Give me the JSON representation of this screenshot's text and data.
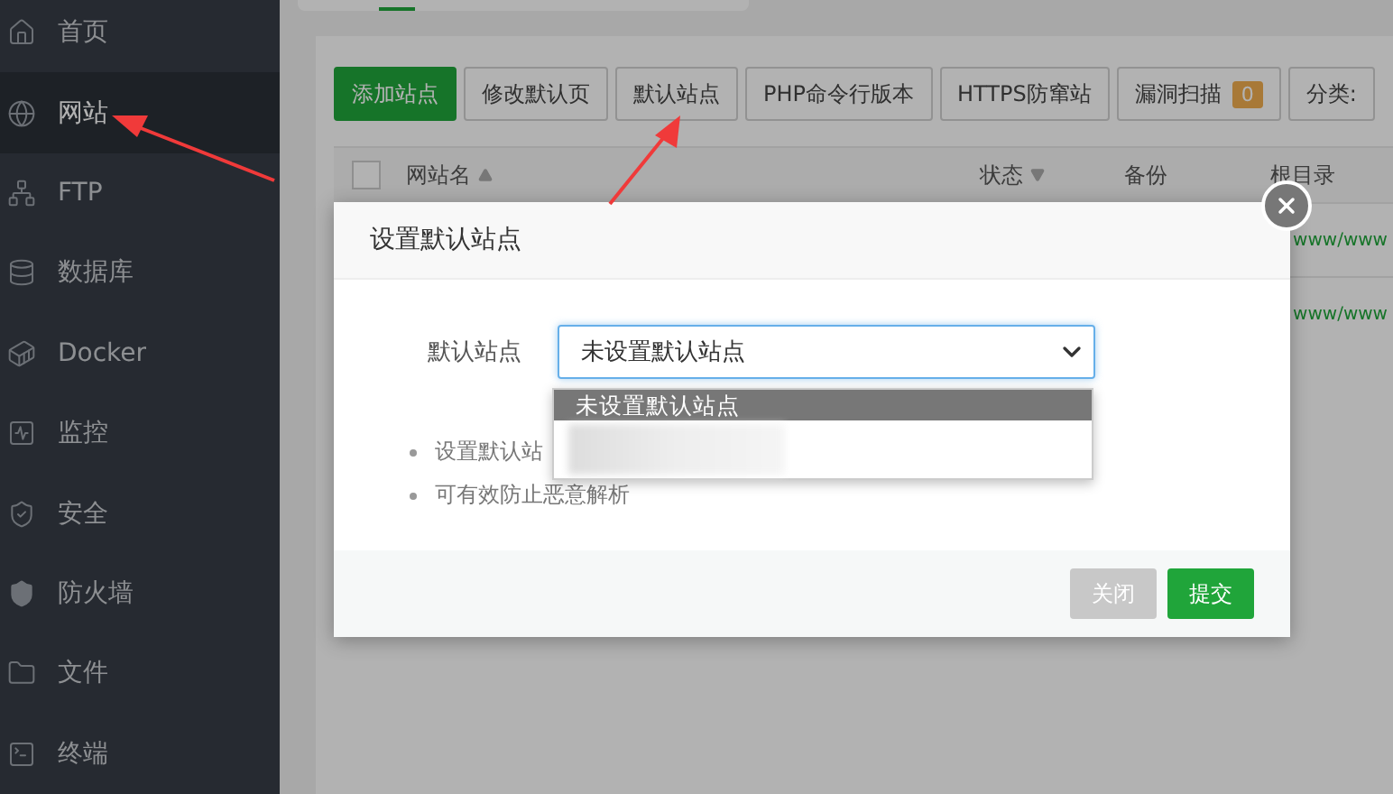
{
  "sidebar": {
    "items": [
      {
        "label": "首页",
        "selected": false
      },
      {
        "label": "网站",
        "selected": true
      },
      {
        "label": "FTP",
        "selected": false
      },
      {
        "label": "数据库",
        "selected": false
      },
      {
        "label": "Docker",
        "selected": false
      },
      {
        "label": "监控",
        "selected": false
      },
      {
        "label": "安全",
        "selected": false
      },
      {
        "label": "防火墙",
        "selected": false
      },
      {
        "label": "文件",
        "selected": false
      },
      {
        "label": "终端",
        "selected": false
      }
    ]
  },
  "toolbar": {
    "buttons": [
      {
        "label": "添加站点",
        "kind": "primary"
      },
      {
        "label": "修改默认页",
        "kind": "default"
      },
      {
        "label": "默认站点",
        "kind": "default"
      },
      {
        "label": "PHP命令行版本",
        "kind": "default"
      },
      {
        "label": "HTTPS防窜站",
        "kind": "default"
      },
      {
        "label": "漏洞扫描",
        "kind": "badge",
        "badge": "0"
      },
      {
        "label": "分类:",
        "kind": "default"
      }
    ]
  },
  "table": {
    "select_all_checked": false,
    "columns": [
      "网站名",
      "状态",
      "备份",
      "根目录"
    ],
    "rows": [
      {
        "root": "www/www"
      },
      {
        "root": "www/www"
      }
    ]
  },
  "dialog": {
    "title": "设置默认站点",
    "field_label": "默认站点",
    "select": {
      "value": "未设置默认站点",
      "expanded": true,
      "options": [
        {
          "label": "未设置默认站点",
          "selected": true
        }
      ]
    },
    "notes": [
      "设置默认站",
      "可有效防止恶意解析"
    ],
    "buttons": [
      {
        "label": "关闭",
        "kind": "secondary"
      },
      {
        "label": "提交",
        "kind": "primary"
      }
    ]
  }
}
